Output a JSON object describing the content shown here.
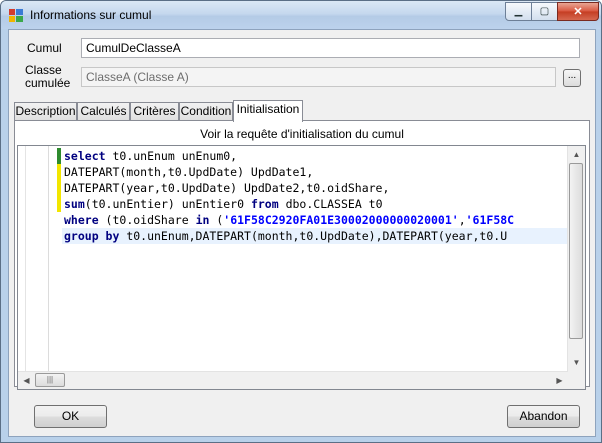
{
  "window": {
    "title": "Informations sur cumul",
    "controls": {
      "minimize": "▁",
      "maximize": "▢",
      "close": "✕"
    }
  },
  "form": {
    "cumul_label": "Cumul",
    "cumul_value": "CumulDeClasseA",
    "classe_label_line1": "Classe",
    "classe_label_line2": "cumulée",
    "classe_value": "ClasseA (Classe A)",
    "browse_label": "..."
  },
  "tabs": [
    {
      "label": "Description"
    },
    {
      "label": "Calculés"
    },
    {
      "label": "Critères"
    },
    {
      "label": "Condition"
    },
    {
      "label": "Initialisation",
      "active": true
    }
  ],
  "panel": {
    "title": "Voir la requête d'initialisation du cumul"
  },
  "sql_lines": [
    [
      {
        "t": "select",
        "k": "kw"
      },
      {
        "t": " t0.unEnum unEnum0,"
      }
    ],
    [
      {
        "t": "DATEPART(month,t0.UpdDate) UpdDate1,"
      }
    ],
    [
      {
        "t": "DATEPART(year,t0.UpdDate) UpdDate2,t0.oidShare,"
      }
    ],
    [
      {
        "t": "sum",
        "k": "kw"
      },
      {
        "t": "(t0.unEntier) unEntier0 "
      },
      {
        "t": "from",
        "k": "kw"
      },
      {
        "t": " dbo.CLASSEA t0"
      }
    ],
    [
      {
        "t": "where",
        "k": "kw"
      },
      {
        "t": " (t0.oidShare "
      },
      {
        "t": "in",
        "k": "kw"
      },
      {
        "t": " ("
      },
      {
        "t": "'61F58C2920FA01E30002000000020001'",
        "k": "str"
      },
      {
        "t": ","
      },
      {
        "t": "'61F58C",
        "k": "str"
      }
    ],
    [
      {
        "t": "group by",
        "k": "kw"
      },
      {
        "t": " t0.unEnum,DATEPART(month,t0.UpdDate),DATEPART(year,t0.U"
      }
    ]
  ],
  "line_markers": [
    "#2e8b2e",
    "#f2e600",
    "#f2e600",
    "#f2e600",
    "",
    ""
  ],
  "buttons": {
    "ok": "OK",
    "cancel": "Abandon"
  },
  "colors": {
    "keyword": "#000080",
    "string": "#0000ff",
    "marker_saved": "#2e8b2e",
    "marker_changed": "#f2e600"
  }
}
